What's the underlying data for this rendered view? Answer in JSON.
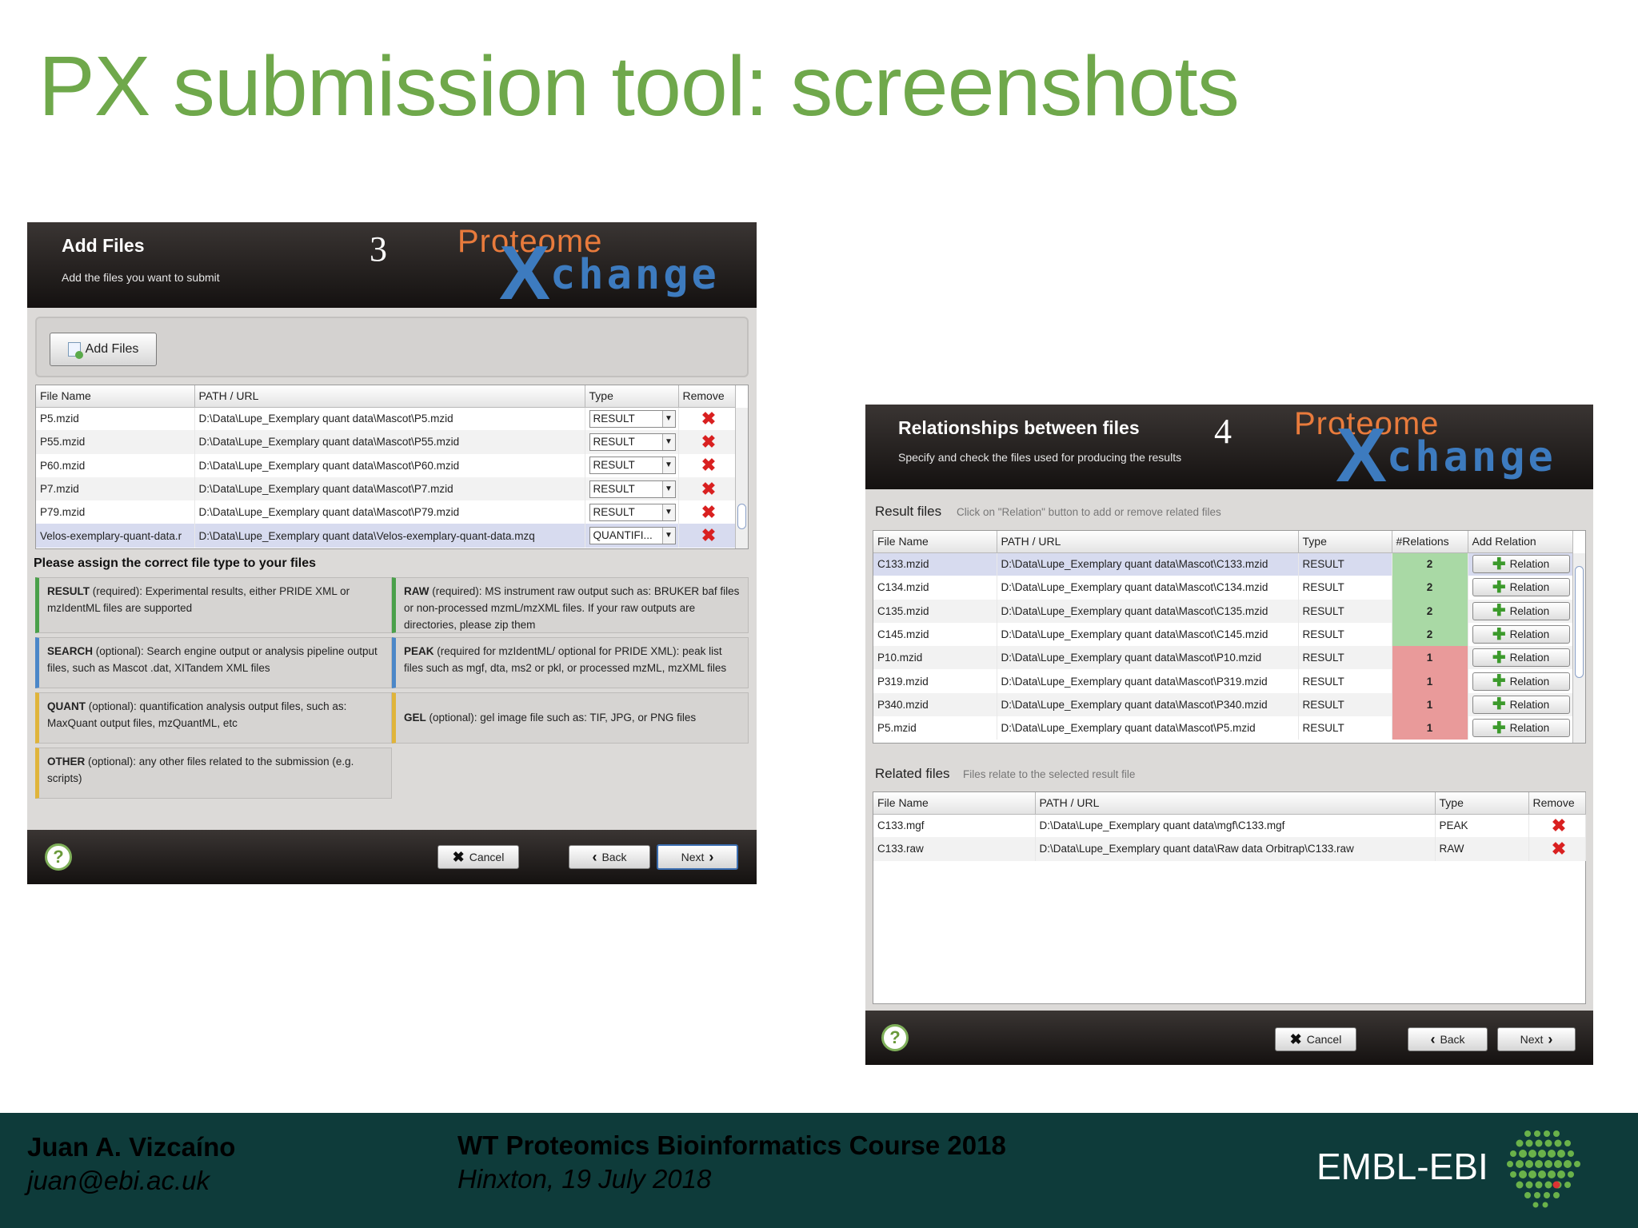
{
  "slide_title": "PX submission tool: screenshots",
  "window1": {
    "header_title": "Add Files",
    "header_subtitle": "Add the files you want to submit",
    "step_number": "3",
    "logo_top": "Proteome",
    "logo_x": "X",
    "logo_bottom": "change",
    "add_files_button": "Add Files",
    "columns": [
      "File Name",
      "PATH / URL",
      "Type",
      "Remove"
    ],
    "rows": [
      {
        "name": "P5.mzid",
        "path": "D:\\Data\\Lupe_Exemplary quant data\\Mascot\\P5.mzid",
        "type": "RESULT"
      },
      {
        "name": "P55.mzid",
        "path": "D:\\Data\\Lupe_Exemplary quant data\\Mascot\\P55.mzid",
        "type": "RESULT"
      },
      {
        "name": "P60.mzid",
        "path": "D:\\Data\\Lupe_Exemplary quant data\\Mascot\\P60.mzid",
        "type": "RESULT"
      },
      {
        "name": "P7.mzid",
        "path": "D:\\Data\\Lupe_Exemplary quant data\\Mascot\\P7.mzid",
        "type": "RESULT"
      },
      {
        "name": "P79.mzid",
        "path": "D:\\Data\\Lupe_Exemplary quant data\\Mascot\\P79.mzid",
        "type": "RESULT"
      },
      {
        "name": "Velos-exemplary-quant-data.r",
        "path": "D:\\Data\\Lupe_Exemplary quant data\\Velos-exemplary-quant-data.mzq",
        "type": "QUANTIFI..."
      }
    ],
    "assign_heading": "Please assign the correct file type to your files",
    "filetypes": {
      "result_name": "RESULT",
      "result_desc": " (required): Experimental results, either PRIDE XML or mzIdentML files are supported",
      "raw_name": "RAW",
      "raw_desc": " (required): MS instrument raw output such as: BRUKER baf files or non-processed mzmL/mzXML files. If your raw outputs are directories, please zip them",
      "search_name": "SEARCH",
      "search_desc": " (optional): Search engine output or analysis pipeline output files, such as Mascot .dat, XITandem XML files",
      "peak_name": "PEAK",
      "peak_desc": " (required for mzIdentML/ optional for PRIDE XML): peak list files such as mgf, dta, ms2 or pkl, or processed mzML, mzXML files",
      "quant_name": "QUANT",
      "quant_desc": " (optional): quantification analysis output files, such as: MaxQuant output files, mzQuantML, etc",
      "gel_name": "GEL",
      "gel_desc": " (optional): gel image file such as: TIF, JPG, or PNG files",
      "other_name": "OTHER",
      "other_desc": " (optional): any other files related to the submission (e.g. scripts)"
    },
    "footer": {
      "help": "?",
      "cancel": "Cancel",
      "back": "Back",
      "next": "Next"
    }
  },
  "window2": {
    "header_title": "Relationships between files",
    "header_subtitle": "Specify and check the files used for producing the results",
    "step_number": "4",
    "logo_top": "Proteome",
    "logo_x": "X",
    "logo_bottom": "change",
    "result_label": "Result files",
    "result_hint": "Click on \"Relation\" button to add or remove related files",
    "result_columns": [
      "File Name",
      "PATH / URL",
      "Type",
      "#Relations",
      "Add Relation"
    ],
    "result_rows": [
      {
        "name": "C133.mzid",
        "path": "D:\\Data\\Lupe_Exemplary quant data\\Mascot\\C133.mzid",
        "type": "RESULT",
        "relations": "2"
      },
      {
        "name": "C134.mzid",
        "path": "D:\\Data\\Lupe_Exemplary quant data\\Mascot\\C134.mzid",
        "type": "RESULT",
        "relations": "2"
      },
      {
        "name": "C135.mzid",
        "path": "D:\\Data\\Lupe_Exemplary quant data\\Mascot\\C135.mzid",
        "type": "RESULT",
        "relations": "2"
      },
      {
        "name": "C145.mzid",
        "path": "D:\\Data\\Lupe_Exemplary quant data\\Mascot\\C145.mzid",
        "type": "RESULT",
        "relations": "2"
      },
      {
        "name": "P10.mzid",
        "path": "D:\\Data\\Lupe_Exemplary quant data\\Mascot\\P10.mzid",
        "type": "RESULT",
        "relations": "1"
      },
      {
        "name": "P319.mzid",
        "path": "D:\\Data\\Lupe_Exemplary quant data\\Mascot\\P319.mzid",
        "type": "RESULT",
        "relations": "1"
      },
      {
        "name": "P340.mzid",
        "path": "D:\\Data\\Lupe_Exemplary quant data\\Mascot\\P340.mzid",
        "type": "RESULT",
        "relations": "1"
      },
      {
        "name": "P5.mzid",
        "path": "D:\\Data\\Lupe_Exemplary quant data\\Mascot\\P5.mzid",
        "type": "RESULT",
        "relations": "1"
      }
    ],
    "relation_button": "Relation",
    "related_label": "Related files",
    "related_hint": "Files relate to the selected result file",
    "related_columns": [
      "File Name",
      "PATH / URL",
      "Type",
      "Remove"
    ],
    "related_rows": [
      {
        "name": "C133.mgf",
        "path": "D:\\Data\\Lupe_Exemplary quant data\\mgf\\C133.mgf",
        "type": "PEAK"
      },
      {
        "name": "C133.raw",
        "path": "D:\\Data\\Lupe_Exemplary quant data\\Raw data Orbitrap\\C133.raw",
        "type": "RAW"
      }
    ],
    "footer": {
      "help": "?",
      "cancel": "Cancel",
      "back": "Back",
      "next": "Next"
    }
  },
  "footer": {
    "author": "Juan A. Vizcaíno",
    "email": "juan@ebi.ac.uk",
    "course": "WT Proteomics Bioinformatics Course 2018",
    "place_date": "Hinxton, 19 July 2018",
    "org": "EMBL-EBI"
  },
  "colors": {
    "title_green": "#6fa84b",
    "footer_bg": "#0e3b3a",
    "logo_orange": "#e97b3c",
    "logo_blue": "#3d7bbf",
    "remove_red": "#d92020",
    "relations_green": "#a9d9a5",
    "relations_red": "#e99a9a"
  }
}
